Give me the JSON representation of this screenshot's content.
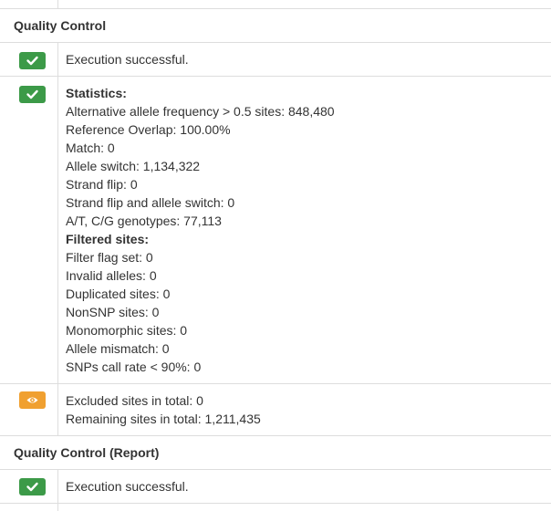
{
  "sections": [
    {
      "title": "Quality Control",
      "rows": [
        {
          "status": "success",
          "icon": "check-icon",
          "lines": [
            {
              "text": "Execution successful.",
              "bold": false
            }
          ]
        },
        {
          "status": "success",
          "icon": "check-icon",
          "lines": [
            {
              "text": "Statistics:",
              "bold": true
            },
            {
              "text": "Alternative allele frequency > 0.5 sites: 848,480",
              "bold": false
            },
            {
              "text": "Reference Overlap: 100.00%",
              "bold": false
            },
            {
              "text": "Match: 0",
              "bold": false
            },
            {
              "text": "Allele switch: 1,134,322",
              "bold": false
            },
            {
              "text": "Strand flip: 0",
              "bold": false
            },
            {
              "text": "Strand flip and allele switch: 0",
              "bold": false
            },
            {
              "text": "A/T, C/G genotypes: 77,113",
              "bold": false
            },
            {
              "text": "Filtered sites:",
              "bold": true
            },
            {
              "text": "Filter flag set: 0",
              "bold": false
            },
            {
              "text": "Invalid alleles: 0",
              "bold": false
            },
            {
              "text": "Duplicated sites: 0",
              "bold": false
            },
            {
              "text": "NonSNP sites: 0",
              "bold": false
            },
            {
              "text": "Monomorphic sites: 0",
              "bold": false
            },
            {
              "text": "Allele mismatch: 0",
              "bold": false
            },
            {
              "text": "SNPs call rate < 90%: 0",
              "bold": false
            }
          ]
        },
        {
          "status": "warning",
          "icon": "eye-icon",
          "lines": [
            {
              "text": "Excluded sites in total: 0",
              "bold": false
            },
            {
              "text": "Remaining sites in total: 1,211,435",
              "bold": false
            }
          ]
        }
      ]
    },
    {
      "title": "Quality Control (Report)",
      "rows": [
        {
          "status": "success",
          "icon": "check-icon",
          "lines": [
            {
              "text": "Execution successful.",
              "bold": false
            }
          ]
        }
      ]
    }
  ],
  "colors": {
    "success": "#3c9a48",
    "warning": "#f0a030",
    "border": "#dddddd",
    "text": "#333333"
  }
}
